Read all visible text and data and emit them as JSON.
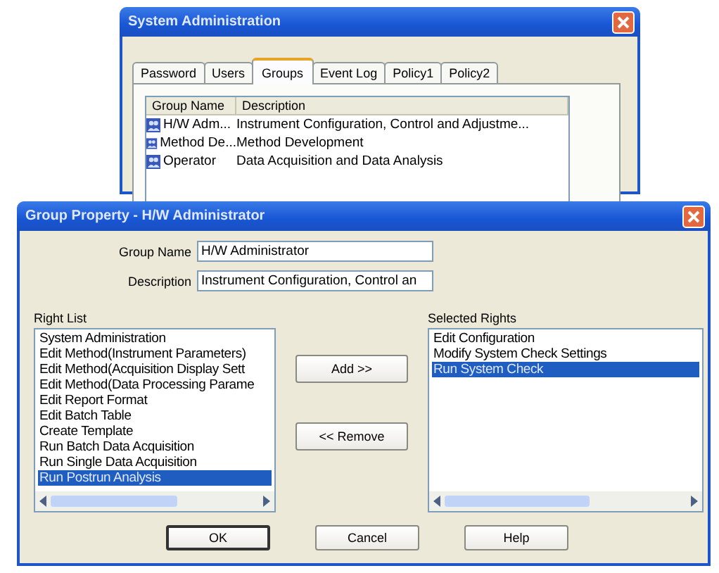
{
  "admin_window": {
    "title": "System Administration",
    "tabs": [
      {
        "label": "Password",
        "selected": false
      },
      {
        "label": "Users",
        "selected": false
      },
      {
        "label": "Groups",
        "selected": true
      },
      {
        "label": "Event Log",
        "selected": false
      },
      {
        "label": "Policy1",
        "selected": false
      },
      {
        "label": "Policy2",
        "selected": false
      }
    ],
    "columns": [
      "Group Name",
      "Description"
    ],
    "rows": [
      {
        "cells": [
          "H/W Adm...",
          "Instrument Configuration, Control and Adjustme..."
        ]
      },
      {
        "cells": [
          "Method De...",
          "Method Development"
        ]
      },
      {
        "cells": [
          "Operator",
          "Data Acquisition and Data Analysis"
        ]
      }
    ]
  },
  "dialog": {
    "title": "Group Property - H/W Administrator",
    "fields": [
      {
        "label": "Group Name",
        "value": "H/W Administrator"
      },
      {
        "label": "Description",
        "value": "Instrument Configuration, Control an"
      }
    ],
    "right_list": {
      "label": "Right List",
      "items": [
        {
          "text": "System Administration",
          "selected": false
        },
        {
          "text": "Edit Method(Instrument Parameters)",
          "selected": false
        },
        {
          "text": "Edit Method(Acquisition Display Sett",
          "selected": false
        },
        {
          "text": "Edit Method(Data Processing Parame",
          "selected": false
        },
        {
          "text": "Edit Report Format",
          "selected": false
        },
        {
          "text": "Edit Batch Table",
          "selected": false
        },
        {
          "text": "Create Template",
          "selected": false
        },
        {
          "text": "Run Batch Data Acquisition",
          "selected": false
        },
        {
          "text": "Run Single Data Acquisition",
          "selected": false
        },
        {
          "text": "Run Postrun Analysis",
          "selected": true
        }
      ]
    },
    "selected_rights": {
      "label": "Selected Rights",
      "items": [
        {
          "text": "Edit Configuration",
          "selected": false
        },
        {
          "text": "Modify System Check Settings",
          "selected": false
        },
        {
          "text": "Run System Check",
          "selected": true
        }
      ]
    },
    "transfer_buttons": [
      "Add >>",
      "<< Remove"
    ],
    "buttons": [
      {
        "label": "OK",
        "default": true
      },
      {
        "label": "Cancel",
        "default": false
      },
      {
        "label": "Help",
        "default": false
      }
    ]
  }
}
